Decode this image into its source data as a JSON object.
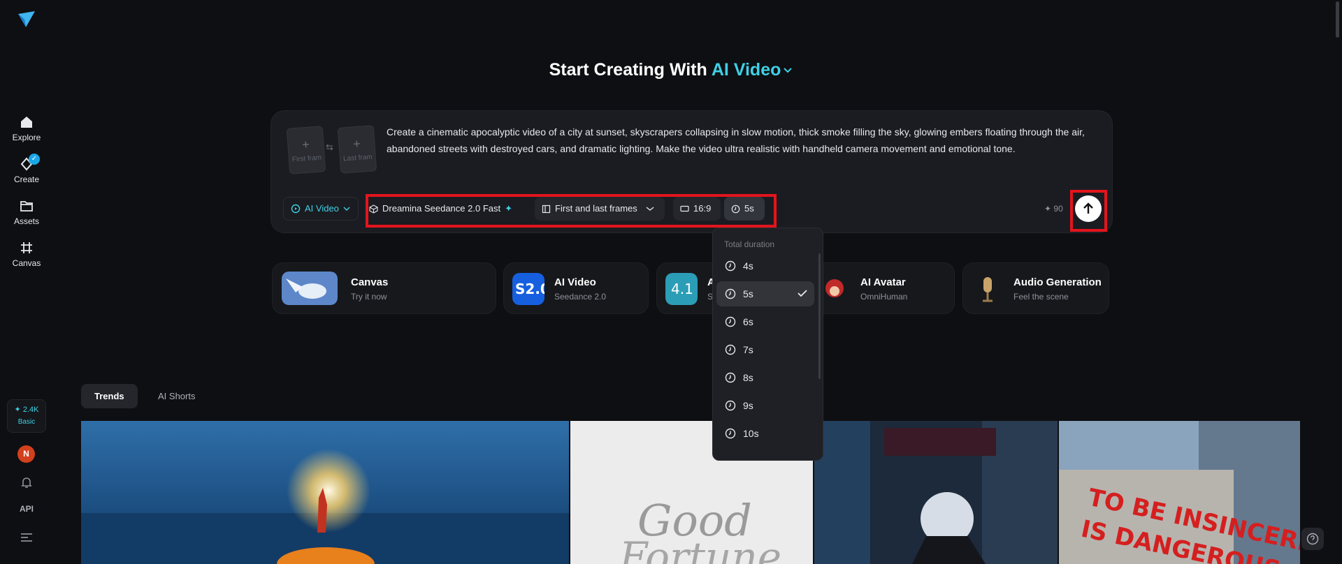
{
  "sidebar": {
    "items": [
      {
        "label": "Explore",
        "icon": "home-icon"
      },
      {
        "label": "Create",
        "icon": "create-icon"
      },
      {
        "label": "Assets",
        "icon": "folder-icon"
      },
      {
        "label": "Canvas",
        "icon": "canvas-icon"
      }
    ],
    "credits": "✦ 2.4K",
    "plan": "Basic",
    "avatar_initial": "N",
    "api_label": "API"
  },
  "header": {
    "title_prefix": "Start Creating With",
    "title_accent": "AI Video"
  },
  "prompt": {
    "first_frame_label": "First fram",
    "last_frame_label": "Last fram",
    "text": "Create a cinematic apocalyptic video of a city at sunset, skyscrapers collapsing in slow motion, thick smoke filling the sky, glowing embers floating through the air, abandoned streets with destroyed cars, and dramatic lighting. Make the video ultra realistic with handheld camera movement and emotional tone.",
    "mode_label": "AI Video",
    "model_label": "Dreamina Seedance 2.0 Fast",
    "frames_label": "First and last frames",
    "ratio_label": "16:9",
    "duration_label": "5s",
    "credit_cost": "✦ 90"
  },
  "features": [
    {
      "title": "Canvas",
      "subtitle": "Try it now"
    },
    {
      "title": "AI Video",
      "subtitle": "Seedance 2.0"
    },
    {
      "title": "A",
      "subtitle": "S"
    },
    {
      "title": "AI Avatar",
      "subtitle": "OmniHuman"
    },
    {
      "title": "Audio Generation",
      "subtitle": "Feel the scene"
    }
  ],
  "duration_menu": {
    "header": "Total duration",
    "options": [
      "4s",
      "5s",
      "6s",
      "7s",
      "8s",
      "9s",
      "10s"
    ],
    "selected": "5s"
  },
  "tabs": [
    "Trends",
    "AI Shorts"
  ],
  "colors": {
    "accent": "#3fd0e6",
    "highlight": "#e3141c",
    "background": "#0e0f12"
  }
}
